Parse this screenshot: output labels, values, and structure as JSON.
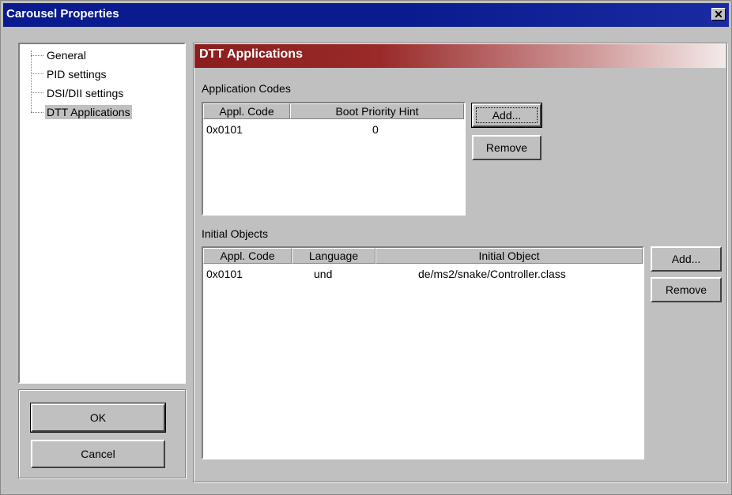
{
  "window": {
    "title": "Carousel Properties",
    "close_label": "✕"
  },
  "tree": {
    "items": [
      {
        "label": "General"
      },
      {
        "label": "PID settings"
      },
      {
        "label": "DSI/DII settings"
      },
      {
        "label": "DTT Applications",
        "selected": true
      }
    ]
  },
  "buttons": {
    "ok": "OK",
    "cancel": "Cancel"
  },
  "page": {
    "header": "DTT Applications"
  },
  "app_codes": {
    "label": "Application Codes",
    "columns": [
      "Appl. Code",
      "Boot Priority Hint"
    ],
    "rows": [
      [
        "0x0101",
        "0"
      ]
    ],
    "add": "Add...",
    "remove": "Remove"
  },
  "initial_objects": {
    "label": "Initial Objects",
    "columns": [
      "Appl. Code",
      "Language",
      "Initial Object"
    ],
    "rows": [
      [
        "0x0101",
        "und",
        "de/ms2/snake/Controller.class"
      ]
    ],
    "add": "Add...",
    "remove": "Remove"
  },
  "colors": {
    "title_bar": "#0a1a8f",
    "header_start": "#8a1e1e",
    "face": "#c0c0c0"
  }
}
